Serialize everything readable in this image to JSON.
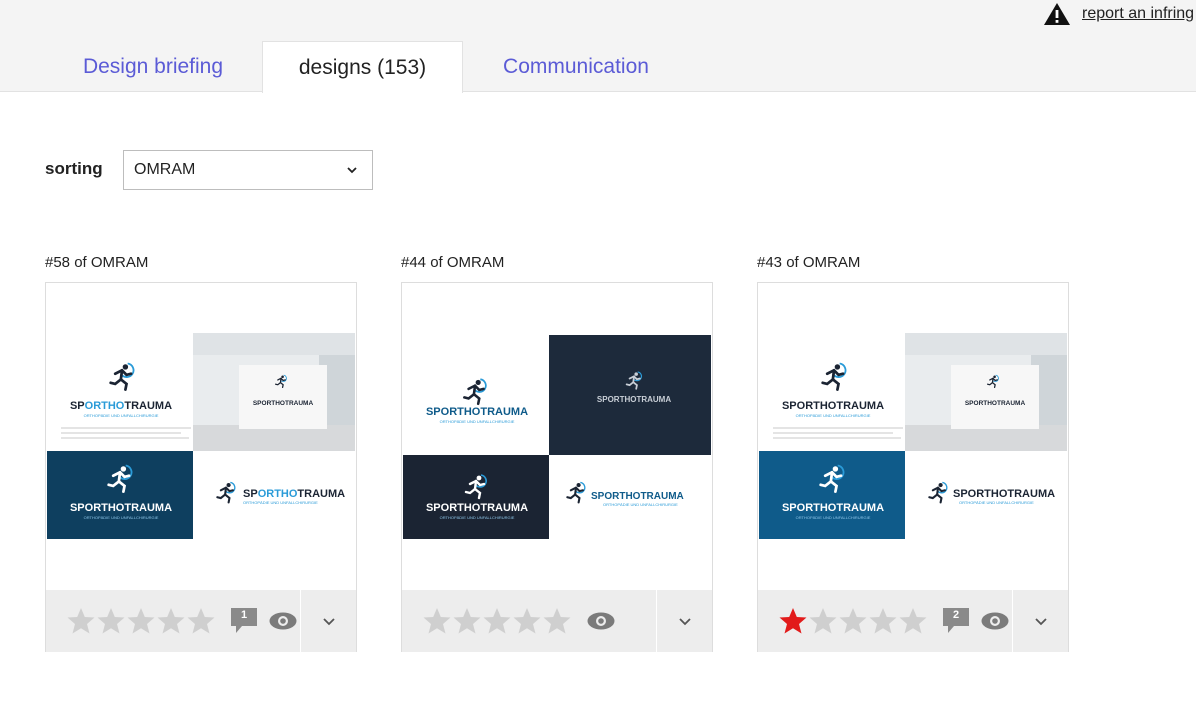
{
  "header": {
    "report_link": "report an infring",
    "tabs": [
      {
        "label": "Design briefing",
        "active": false
      },
      {
        "label": "designs (153)",
        "active": true
      },
      {
        "label": "Communication",
        "active": false
      }
    ]
  },
  "sorting": {
    "label": "sorting",
    "selected": "OMRAM"
  },
  "colors": {
    "tab_link": "#5b5bd6",
    "star_empty": "#cfcfcf",
    "star_filled": "#e21b1b",
    "bar_bg": "#ededed",
    "navy_tile": "#0e3f5f",
    "dark_tile": "#1b2433",
    "blue_tile": "#0f5b8a",
    "accent_blue": "#2a9bd8"
  },
  "logo_text": {
    "brand_dark_part": "SP",
    "brand_blue_part": "ORTHO",
    "brand_end": "TRAUMA",
    "brand_full": "SPORTHOTRAUMA",
    "tagline": "ORTHOPÄDIE UND UNFALLCHIRURGIE"
  },
  "designs": [
    {
      "title": "#58 of OMRAM",
      "rating": 0,
      "max_rating": 5,
      "comments": "1",
      "variant": "navy"
    },
    {
      "title": "#44 of OMRAM",
      "rating": 0,
      "max_rating": 5,
      "comments": null,
      "variant": "dark"
    },
    {
      "title": "#43 of OMRAM",
      "rating": 1,
      "max_rating": 5,
      "comments": "2",
      "variant": "blue"
    }
  ],
  "icons": {
    "warning": "warning-icon",
    "chevron": "chevron-down-icon",
    "star": "star-icon",
    "comment": "comment-icon",
    "eye": "eye-icon"
  }
}
